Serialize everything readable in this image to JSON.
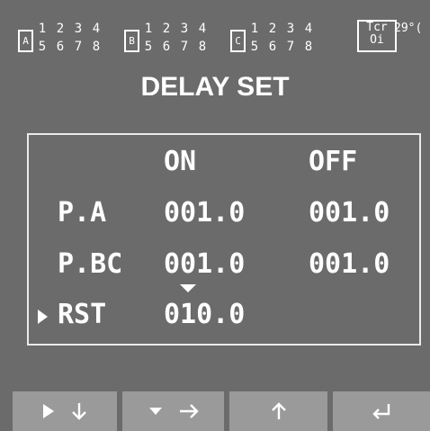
{
  "status_bar": {
    "groups": [
      {
        "label": "A",
        "top": [
          "1",
          "2",
          "3",
          "4"
        ],
        "bottom": [
          "5",
          "6",
          "7",
          "8"
        ]
      },
      {
        "label": "B",
        "top": [
          "1",
          "2",
          "3",
          "4"
        ],
        "bottom": [
          "5",
          "6",
          "7",
          "8"
        ]
      },
      {
        "label": "C",
        "top": [
          "1",
          "2",
          "3",
          "4"
        ],
        "bottom": [
          "5",
          "6",
          "7",
          "8"
        ]
      }
    ],
    "tcr_top": "Tcr",
    "tcr_bottom": "Oi",
    "temperature": "29°("
  },
  "title": "DELAY SET",
  "table": {
    "headers": {
      "on": "ON",
      "off": "OFF"
    },
    "rows": [
      {
        "label": "P.A",
        "on": "001.0",
        "off": "001.0"
      },
      {
        "label": "P.BC",
        "on": "001.0",
        "off": "001.0"
      },
      {
        "label": "RST",
        "on": "010.0",
        "off": ""
      }
    ],
    "selected_row": "RST"
  },
  "softkeys": [
    {
      "icons": [
        "play-right-icon",
        "arrow-down-icon"
      ]
    },
    {
      "icons": [
        "caret-down-icon",
        "arrow-right-icon"
      ]
    },
    {
      "icons": [
        "arrow-up-icon"
      ]
    },
    {
      "icons": [
        "enter-icon"
      ]
    }
  ],
  "colors": {
    "background": "#6b6b6b",
    "foreground": "#ffffff",
    "softkey": "#9a9a9a"
  }
}
